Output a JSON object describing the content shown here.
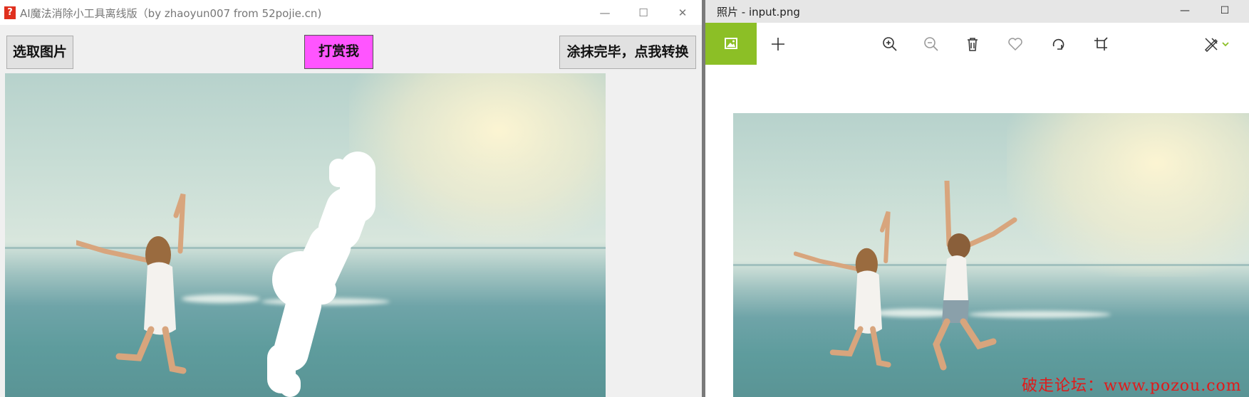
{
  "left_window": {
    "app_icon_glyph": "?",
    "title": "AI魔法消除小工具离线版（by zhaoyun007 from 52pojie.cn)",
    "controls": {
      "minimize": "—",
      "maximize": "☐",
      "close": "✕"
    },
    "buttons": {
      "select_image": "选取图片",
      "tip_me": "打赏我",
      "convert": "涂抹完毕，点我转换"
    },
    "colors": {
      "tip_button": "#ff55ff",
      "background": "#f0f0f0",
      "brush_mask": "#ffffff"
    }
  },
  "right_window": {
    "title": "照片 - input.png",
    "controls": {
      "minimize": "—",
      "maximize": "☐"
    },
    "toolbar": {
      "gallery_icon": "image-gallery-icon",
      "add_icon": "plus-icon",
      "zoom_in_icon": "zoom-in-icon",
      "zoom_out_icon": "zoom-out-icon",
      "delete_icon": "trash-icon",
      "favorite_icon": "heart-icon",
      "rotate_icon": "rotate-icon",
      "crop_icon": "crop-icon",
      "edit_icon": "edit-draw-icon",
      "dropdown_icon": "chevron-down-icon"
    },
    "colors": {
      "accent": "#8cbf26",
      "titlebar": "#e6e6e6"
    }
  },
  "watermark": "破走论坛：www.pozou.com"
}
